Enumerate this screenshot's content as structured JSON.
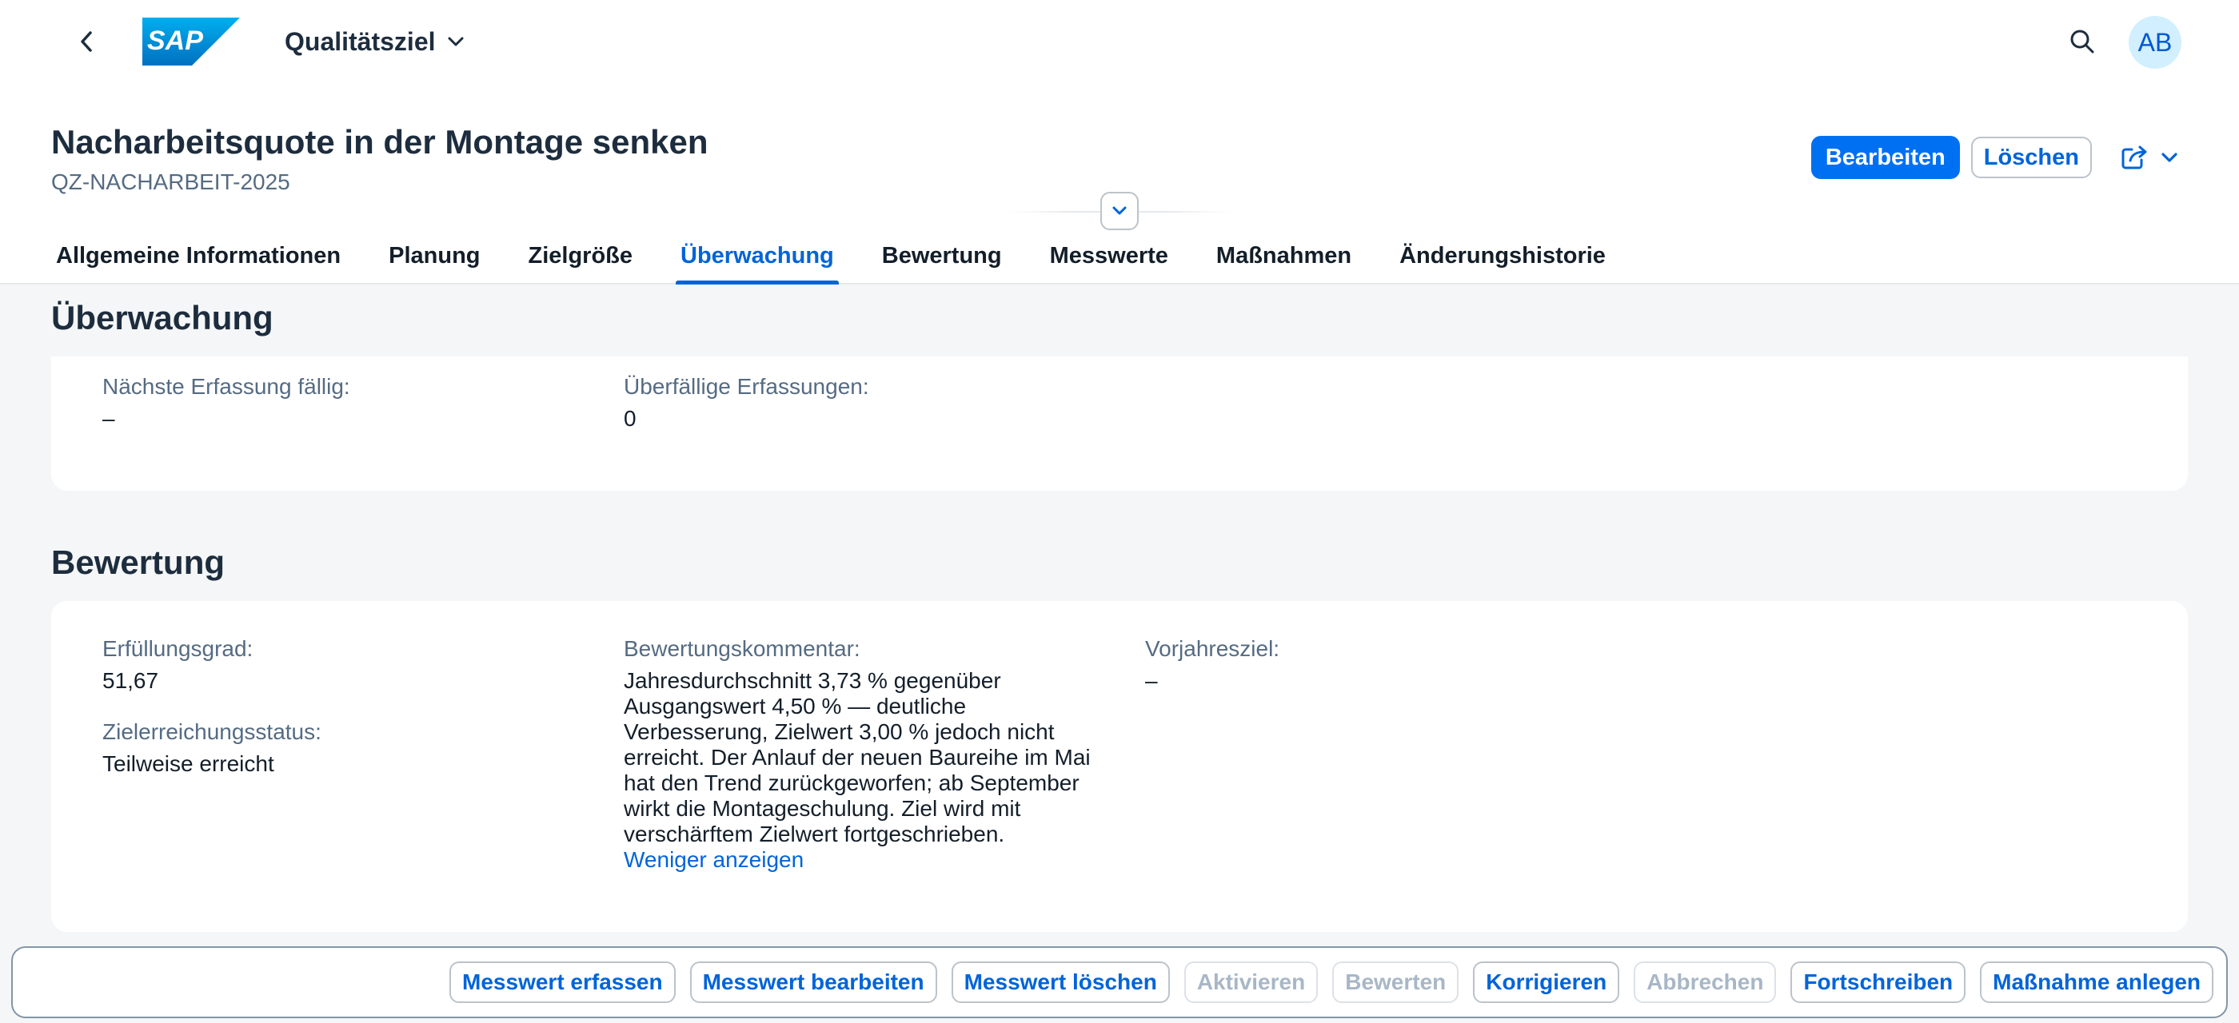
{
  "shell": {
    "logo_text": "SAP",
    "app_title": "Qualitätsziel",
    "avatar_initials": "AB"
  },
  "header": {
    "title": "Nacharbeitsquote in der Montage senken",
    "subtitle": "QZ-NACHARBEIT-2025",
    "actions": {
      "edit": "Bearbeiten",
      "delete": "Löschen"
    }
  },
  "tabs": [
    {
      "label": "Allgemeine Informationen",
      "active": false
    },
    {
      "label": "Planung",
      "active": false
    },
    {
      "label": "Zielgröße",
      "active": false
    },
    {
      "label": "Überwachung",
      "active": true
    },
    {
      "label": "Bewertung",
      "active": false
    },
    {
      "label": "Messwerte",
      "active": false
    },
    {
      "label": "Maßnahmen",
      "active": false
    },
    {
      "label": "Änderungshistorie",
      "active": false
    }
  ],
  "monitoring": {
    "title": "Überwachung",
    "next_capture_label": "Nächste Erfassung fällig:",
    "next_capture_value": "–",
    "overdue_label": "Überfällige Erfassungen:",
    "overdue_value": "0"
  },
  "evaluation": {
    "title": "Bewertung",
    "fulfillment_label": "Erfüllungsgrad:",
    "fulfillment_value": "51,67",
    "status_label": "Zielerreichungsstatus:",
    "status_value": "Teilweise erreicht",
    "comment_label": "Bewertungskommentar:",
    "comment_value": "Jahresdurchschnitt 3,73 % gegenüber Ausgangswert 4,50 % — deutliche Verbesserung, Zielwert 3,00 % jedoch nicht erreicht. Der Anlauf der neuen Baureihe im Mai hat den Trend zurückgeworfen; ab September wirkt die Montageschulung. Ziel wird mit verschärftem Zielwert fortgeschrieben.",
    "show_less": "Weniger anzeigen",
    "prev_year_label": "Vorjahresziel:",
    "prev_year_value": "–"
  },
  "footer": {
    "buttons": [
      {
        "label": "Messwert erfassen",
        "enabled": true
      },
      {
        "label": "Messwert bearbeiten",
        "enabled": true
      },
      {
        "label": "Messwert löschen",
        "enabled": true
      },
      {
        "label": "Aktivieren",
        "enabled": false
      },
      {
        "label": "Bewerten",
        "enabled": false
      },
      {
        "label": "Korrigieren",
        "enabled": true
      },
      {
        "label": "Abbrechen",
        "enabled": false
      },
      {
        "label": "Fortschreiben",
        "enabled": true
      },
      {
        "label": "Maßnahme anlegen",
        "enabled": true
      }
    ]
  },
  "colors": {
    "brand_blue": "#0070f2",
    "link_blue": "#0064d9",
    "background": "#f5f6f7"
  },
  "icons": [
    "back-arrow-icon",
    "chevron-down-icon",
    "search-icon",
    "share-icon",
    "collapse-header-icon"
  ]
}
